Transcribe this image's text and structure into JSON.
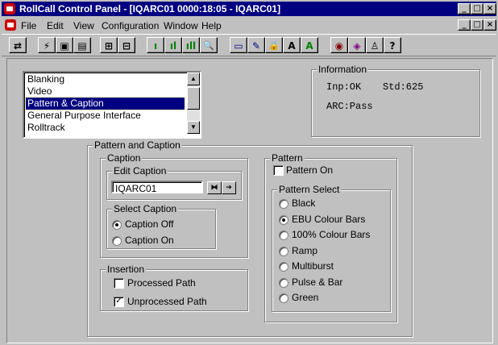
{
  "window": {
    "title": "RollCall Control Panel - [IQARC01 0000:18:05 - IQARC01]",
    "title_buttons": [
      "_",
      "□",
      "×"
    ],
    "mdi_buttons": [
      "_",
      "□",
      "×"
    ]
  },
  "menu": [
    "File",
    "Edit",
    "View",
    "Configuration",
    "Window",
    "Help"
  ],
  "toolbar": {
    "buttons": [
      {
        "name": "connect-icon",
        "glyph": "⇄"
      },
      {
        "name": "flash-icon",
        "glyph": "⚡"
      },
      {
        "name": "save-icon",
        "glyph": "▣"
      },
      {
        "name": "save-all-icon",
        "glyph": "▤"
      },
      {
        "name": "network-icon",
        "glyph": "⊞"
      },
      {
        "name": "node-icon",
        "glyph": "⊟"
      },
      {
        "name": "bar-small-icon",
        "glyph": "ı"
      },
      {
        "name": "bar-medium-icon",
        "glyph": "ıl"
      },
      {
        "name": "bar-large-icon",
        "glyph": "ıll"
      },
      {
        "name": "search-icon",
        "glyph": "🔍"
      },
      {
        "name": "book-icon",
        "glyph": "▭"
      },
      {
        "name": "edit-doc-icon",
        "glyph": "✎"
      },
      {
        "name": "lock-icon",
        "glyph": "🔒"
      },
      {
        "name": "font-black-icon",
        "glyph": "A"
      },
      {
        "name": "font-green-icon",
        "glyph": "A"
      },
      {
        "name": "monitor-icon",
        "glyph": "◉"
      },
      {
        "name": "log-icon",
        "glyph": "◈"
      },
      {
        "name": "user-icon",
        "glyph": "♙"
      },
      {
        "name": "help-icon",
        "glyph": "?"
      }
    ]
  },
  "list": {
    "items": [
      "Blanking",
      "Video",
      "Pattern & Caption",
      "General Purpose Interface",
      "Rolltrack"
    ],
    "selected_index": 2
  },
  "information": {
    "title": "Information",
    "input_status": "Inp:OK",
    "standard": "Std:625",
    "arc_status": "ARC:Pass"
  },
  "pattern_and_caption": {
    "title": "Pattern and Caption",
    "caption": {
      "title": "Caption",
      "edit_caption": {
        "title": "Edit Caption",
        "value": "IQARC01"
      },
      "select_caption": {
        "title": "Select Caption",
        "options": [
          {
            "label": "Caption Off",
            "selected": true
          },
          {
            "label": "Caption On",
            "selected": false
          }
        ]
      }
    },
    "insertion": {
      "title": "Insertion",
      "options": [
        {
          "label": "Processed Path",
          "checked": false
        },
        {
          "label": "Unprocessed Path",
          "checked": true
        }
      ]
    },
    "pattern": {
      "title": "Pattern",
      "pattern_on": {
        "label": "Pattern On",
        "checked": false
      },
      "pattern_select": {
        "title": "Pattern Select",
        "options": [
          {
            "label": "Black",
            "selected": false
          },
          {
            "label": "EBU Colour Bars",
            "selected": true
          },
          {
            "label": "100% Colour Bars",
            "selected": false
          },
          {
            "label": "Ramp",
            "selected": false
          },
          {
            "label": "Multiburst",
            "selected": false
          },
          {
            "label": "Pulse & Bar",
            "selected": false
          },
          {
            "label": "Green",
            "selected": false
          }
        ]
      }
    }
  },
  "colors": {
    "title_bar": "#000080",
    "face": "#c0c0c0",
    "selection": "#000080",
    "app_icon": "#cc0000"
  }
}
